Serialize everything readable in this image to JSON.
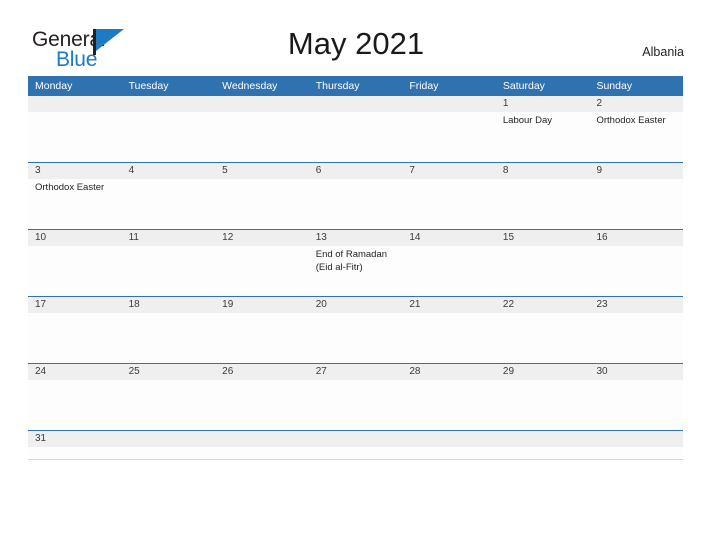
{
  "brand": {
    "name_part1": "General",
    "name_part2": "Blue",
    "accent_color": "#1f7ac4",
    "flag_icon": "flag-triangle-icon"
  },
  "header": {
    "title": "May 2021",
    "region": "Albania"
  },
  "calendar": {
    "header_bg": "#3071b0",
    "day_band_bg": "#efefef",
    "weekdays": [
      "Monday",
      "Tuesday",
      "Wednesday",
      "Thursday",
      "Friday",
      "Saturday",
      "Sunday"
    ],
    "weeks": [
      {
        "days": [
          {
            "num": "",
            "events": []
          },
          {
            "num": "",
            "events": []
          },
          {
            "num": "",
            "events": []
          },
          {
            "num": "",
            "events": []
          },
          {
            "num": "",
            "events": []
          },
          {
            "num": "1",
            "events": [
              "Labour Day"
            ]
          },
          {
            "num": "2",
            "events": [
              "Orthodox Easter"
            ]
          }
        ]
      },
      {
        "days": [
          {
            "num": "3",
            "events": [
              "Orthodox Easter"
            ]
          },
          {
            "num": "4",
            "events": []
          },
          {
            "num": "5",
            "events": []
          },
          {
            "num": "6",
            "events": []
          },
          {
            "num": "7",
            "events": []
          },
          {
            "num": "8",
            "events": []
          },
          {
            "num": "9",
            "events": []
          }
        ]
      },
      {
        "days": [
          {
            "num": "10",
            "events": []
          },
          {
            "num": "11",
            "events": []
          },
          {
            "num": "12",
            "events": []
          },
          {
            "num": "13",
            "events": [
              "End of Ramadan",
              "(Eid al-Fitr)"
            ]
          },
          {
            "num": "14",
            "events": []
          },
          {
            "num": "15",
            "events": []
          },
          {
            "num": "16",
            "events": []
          }
        ]
      },
      {
        "days": [
          {
            "num": "17",
            "events": []
          },
          {
            "num": "18",
            "events": []
          },
          {
            "num": "19",
            "events": []
          },
          {
            "num": "20",
            "events": []
          },
          {
            "num": "21",
            "events": []
          },
          {
            "num": "22",
            "events": []
          },
          {
            "num": "23",
            "events": []
          }
        ]
      },
      {
        "days": [
          {
            "num": "24",
            "events": []
          },
          {
            "num": "25",
            "events": []
          },
          {
            "num": "26",
            "events": []
          },
          {
            "num": "27",
            "events": []
          },
          {
            "num": "28",
            "events": []
          },
          {
            "num": "29",
            "events": []
          },
          {
            "num": "30",
            "events": []
          }
        ]
      },
      {
        "days": [
          {
            "num": "31",
            "events": []
          },
          {
            "num": "",
            "events": []
          },
          {
            "num": "",
            "events": []
          },
          {
            "num": "",
            "events": []
          },
          {
            "num": "",
            "events": []
          },
          {
            "num": "",
            "events": []
          },
          {
            "num": "",
            "events": []
          }
        ]
      }
    ]
  }
}
